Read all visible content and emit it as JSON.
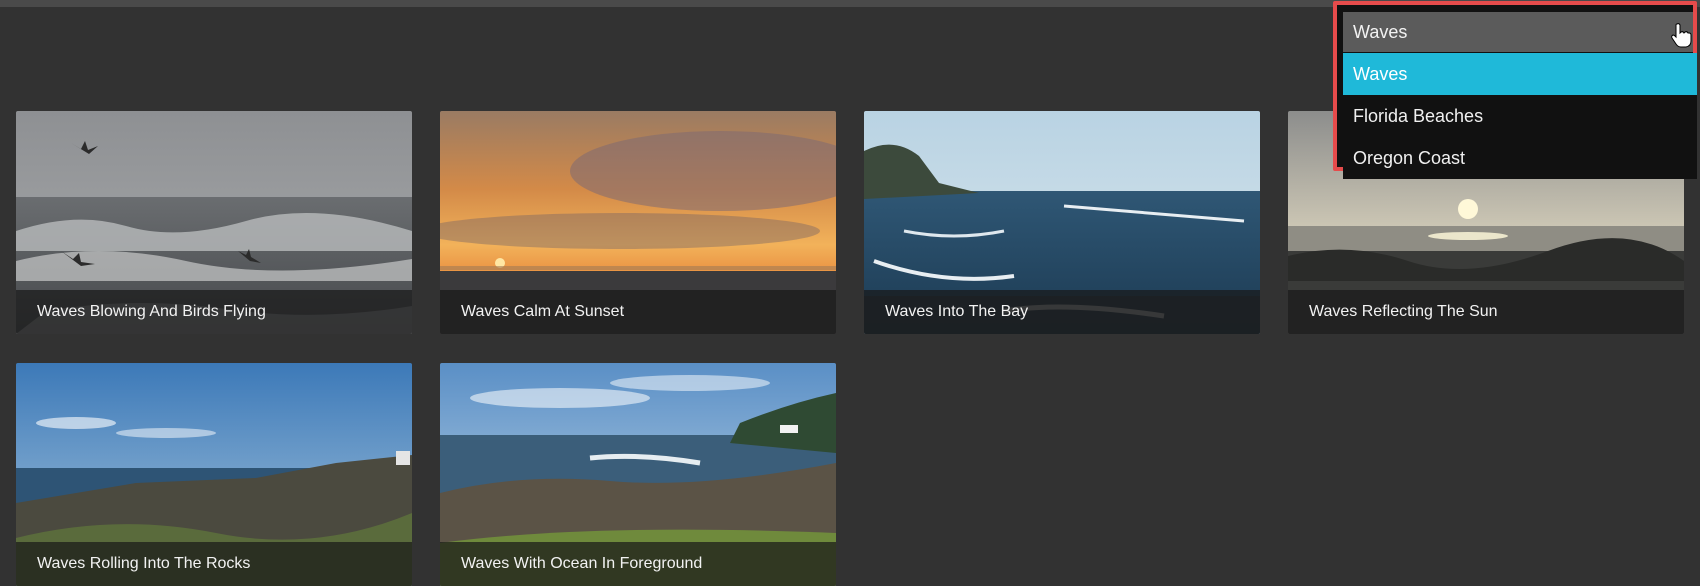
{
  "gallery": {
    "cards": [
      {
        "title": "Waves Blowing And Birds Flying",
        "thumb_icon": "stormy-sea-with-birds-image"
      },
      {
        "title": "Waves Calm At Sunset",
        "thumb_icon": "sunset-over-sea-image"
      },
      {
        "title": "Waves Into The Bay",
        "thumb_icon": "bay-with-waves-image"
      },
      {
        "title": "Waves Reflecting The Sun",
        "thumb_icon": "sun-reflecting-on-water-image"
      },
      {
        "title": "Waves Rolling Into The Rocks",
        "thumb_icon": "rocky-shore-image"
      },
      {
        "title": "Waves With Ocean In Foreground",
        "thumb_icon": "coastline-with-grass-image"
      }
    ]
  },
  "category_select": {
    "selected_value": "Waves",
    "options": [
      {
        "label": "Waves",
        "selected": true
      },
      {
        "label": "Florida Beaches",
        "selected": false
      },
      {
        "label": "Oregon Coast",
        "selected": false
      }
    ],
    "highlight_color": "#1fb9d9",
    "focus_border_color": "#e64b4b"
  },
  "colors": {
    "background": "#323232",
    "caption_bg": "rgba(25,25,25,0.72)"
  }
}
